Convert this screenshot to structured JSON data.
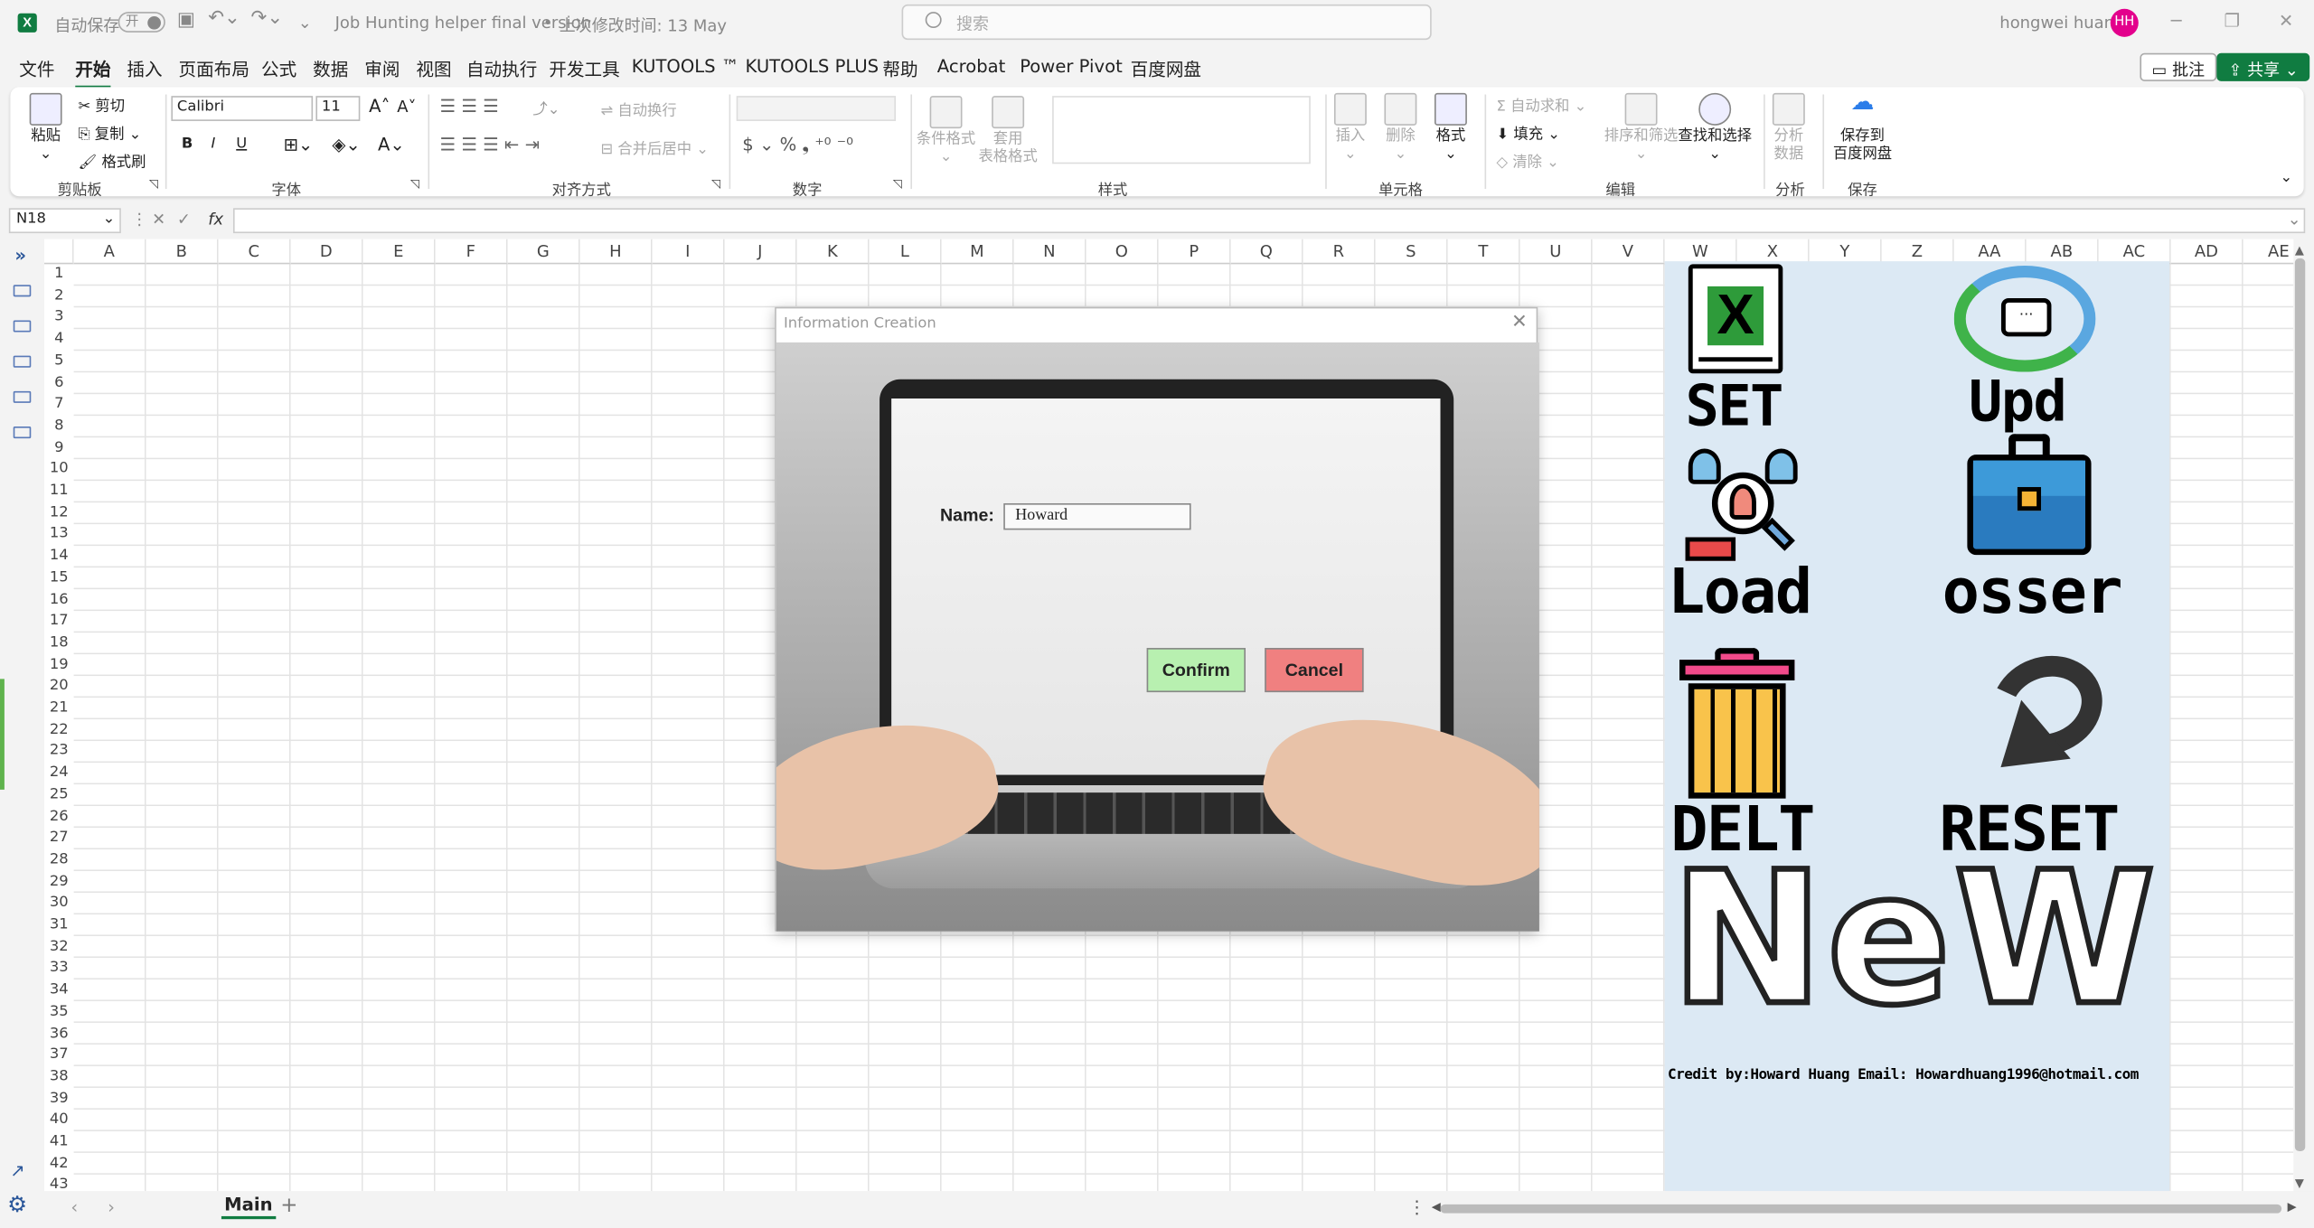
{
  "titlebar": {
    "autosave": "自动保存",
    "toggle": "开",
    "filename": "Job Hunting helper final version",
    "modified": "上次修改时间: 13 May",
    "search_placeholder": "搜索",
    "user": "hongwei huang",
    "avatar_initials": "HH"
  },
  "menu": [
    "文件",
    "开始",
    "插入",
    "页面布局",
    "公式",
    "数据",
    "审阅",
    "视图",
    "自动执行",
    "开发工具",
    "KUTOOLS ™",
    "KUTOOLS PLUS",
    "帮助",
    "Acrobat",
    "Power Pivot",
    "百度网盘"
  ],
  "active_menu": "开始",
  "top_buttons": {
    "comments": "批注",
    "share": "共享"
  },
  "ribbon": {
    "groups": [
      "剪贴板",
      "字体",
      "对齐方式",
      "数字",
      "样式",
      "单元格",
      "编辑",
      "分析",
      "保存"
    ],
    "clipboard": {
      "paste": "粘贴",
      "cut": "剪切",
      "copy": "复制",
      "format_painter": "格式刷"
    },
    "font": {
      "name": "Calibri",
      "size": "11",
      "bold": "B",
      "italic": "I",
      "underline": "U"
    },
    "alignment": {
      "wrap": "自动换行",
      "merge": "合并后居中"
    },
    "number": {
      "format": ""
    },
    "styles": {
      "conditional": "条件格式",
      "table_format": "套用\n表格格式"
    },
    "cells": {
      "insert": "插入",
      "delete": "删除",
      "format": "格式"
    },
    "editing": {
      "autosum": "自动求和",
      "fill": "填充",
      "clear": "清除",
      "sort": "排序和筛选",
      "find": "查找和选择"
    },
    "analysis": {
      "analyze": "分析\n数据"
    },
    "save": {
      "baidu": "保存到\n百度网盘"
    }
  },
  "formula": {
    "cell_ref": "N18",
    "fx": "fx",
    "value": ""
  },
  "columns": [
    "A",
    "B",
    "C",
    "D",
    "E",
    "F",
    "G",
    "H",
    "I",
    "J",
    "K",
    "L",
    "M",
    "N",
    "O",
    "P",
    "Q",
    "R",
    "S",
    "T",
    "U",
    "V",
    "W",
    "X",
    "Y",
    "Z",
    "AA",
    "AB",
    "AC",
    "AD",
    "AE"
  ],
  "rows": [
    "1",
    "2",
    "3",
    "4",
    "5",
    "6",
    "7",
    "8",
    "9",
    "10",
    "11",
    "12",
    "13",
    "14",
    "15",
    "16",
    "17",
    "18",
    "19",
    "20",
    "21",
    "22",
    "23",
    "24",
    "25",
    "26",
    "27",
    "28",
    "29",
    "30",
    "31",
    "32",
    "33",
    "34",
    "35",
    "36",
    "37",
    "38",
    "39",
    "40",
    "41",
    "42",
    "43"
  ],
  "panel": {
    "set": "SET",
    "upd": "Upd",
    "load": "Load",
    "osser": "osser",
    "delt": "DELT",
    "reset": "RESET",
    "new": "NeW",
    "credit": "Credit by:Howard Huang Email: Howardhuang1996@hotmail.com"
  },
  "dialog": {
    "title": "Information Creation",
    "name_label": "Name:",
    "name_value": "Howard",
    "confirm": "Confirm",
    "cancel": "Cancel"
  },
  "sheet_tab": "Main"
}
